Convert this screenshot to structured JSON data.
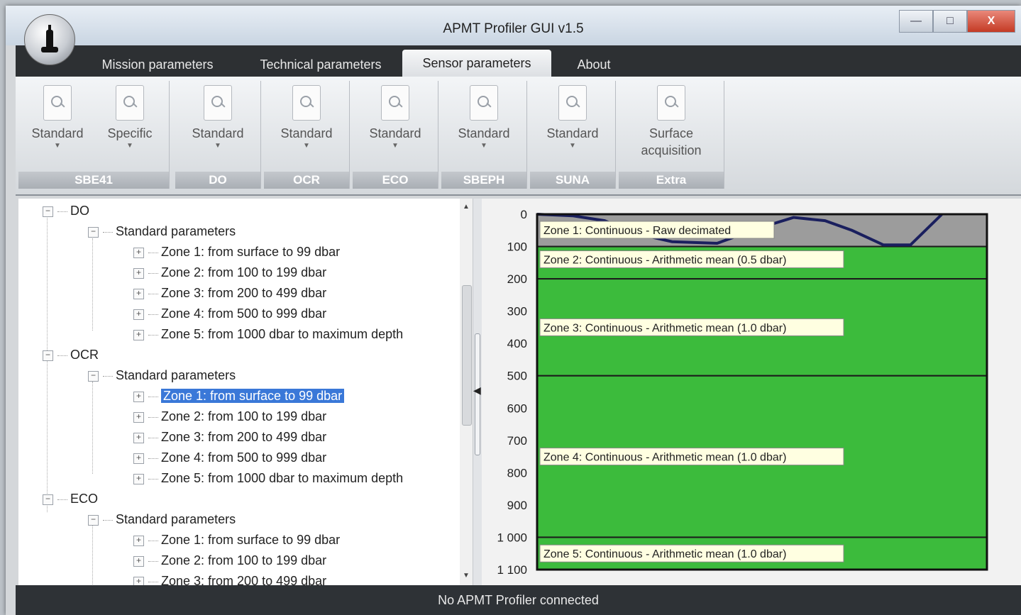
{
  "window": {
    "title": "APMT Profiler GUI v1.5",
    "controls": {
      "minimize": "—",
      "maximize": "□",
      "close": "X"
    }
  },
  "tabs": [
    {
      "label": "Mission parameters",
      "active": false
    },
    {
      "label": "Technical parameters",
      "active": false
    },
    {
      "label": "Sensor parameters",
      "active": true
    },
    {
      "label": "About",
      "active": false
    }
  ],
  "ribbon": {
    "groups": [
      {
        "name": "SBE41",
        "buttons": [
          {
            "label": "Standard",
            "icon": "settings-icon"
          },
          {
            "label": "Specific",
            "icon": "settings-icon"
          }
        ]
      },
      {
        "name": "DO",
        "buttons": [
          {
            "label": "Standard",
            "icon": "settings-icon"
          }
        ]
      },
      {
        "name": "OCR",
        "buttons": [
          {
            "label": "Standard",
            "icon": "settings-icon"
          }
        ]
      },
      {
        "name": "ECO",
        "buttons": [
          {
            "label": "Standard",
            "icon": "settings-icon"
          }
        ]
      },
      {
        "name": "SBEPH",
        "buttons": [
          {
            "label": "Standard",
            "icon": "settings-icon"
          }
        ]
      },
      {
        "name": "SUNA",
        "buttons": [
          {
            "label": "Standard",
            "icon": "settings-icon"
          }
        ]
      },
      {
        "name": "Extra",
        "buttons": [
          {
            "label": "Surface acquisition",
            "icon": "settings-icon"
          }
        ]
      }
    ]
  },
  "tree": {
    "sensors": [
      {
        "name": "DO",
        "group": "Standard parameters",
        "zones": [
          "Zone 1: from surface to 99 dbar",
          "Zone 2: from 100 to 199 dbar",
          "Zone 3: from 200 to 499 dbar",
          "Zone 4: from 500 to 999 dbar",
          "Zone 5: from 1000 dbar to maximum depth"
        ]
      },
      {
        "name": "OCR",
        "group": "Standard parameters",
        "zones": [
          "Zone 1: from surface to 99 dbar",
          "Zone 2: from 100 to 199 dbar",
          "Zone 3: from 200 to 499 dbar",
          "Zone 4: from 500 to 999 dbar",
          "Zone 5: from 1000 dbar to maximum depth"
        ],
        "selected_zone": 0
      },
      {
        "name": "ECO",
        "group": "Standard parameters",
        "zones": [
          "Zone 1: from surface to 99 dbar",
          "Zone 2: from 100 to 199 dbar",
          "Zone 3: from 200 to 499 dbar"
        ]
      }
    ]
  },
  "chart_data": {
    "type": "area",
    "y_axis": {
      "ticks": [
        "0",
        "100",
        "200",
        "300",
        "400",
        "500",
        "600",
        "700",
        "800",
        "900",
        "1 000",
        "1 100"
      ],
      "range": [
        0,
        1100
      ],
      "inverted": true
    },
    "zones": [
      {
        "label": "Zone 1: Continuous - Raw decimated",
        "from": 0,
        "to": 99,
        "color": "#9c9c9c"
      },
      {
        "label": "Zone 2: Continuous - Arithmetic mean (0.5 dbar)",
        "from": 100,
        "to": 199,
        "color": "#3cbb3c"
      },
      {
        "label": "Zone 3: Continuous - Arithmetic mean (1.0 dbar)",
        "from": 200,
        "to": 499,
        "color": "#3cbb3c"
      },
      {
        "label": "Zone 4: Continuous - Arithmetic mean (1.0 dbar)",
        "from": 500,
        "to": 999,
        "color": "#3cbb3c"
      },
      {
        "label": "Zone 5: Continuous - Arithmetic mean (1.0 dbar)",
        "from": 1000,
        "to": 1100,
        "color": "#3cbb3c"
      }
    ],
    "profile_line": {
      "color": "#1a1f5e",
      "x": [
        0,
        0.08,
        0.15,
        0.22,
        0.3,
        0.4,
        0.5,
        0.57,
        0.64,
        0.7,
        0.77,
        0.83,
        0.9
      ],
      "y": [
        0,
        5,
        20,
        60,
        85,
        90,
        40,
        10,
        20,
        50,
        95,
        95,
        0
      ]
    }
  },
  "status": {
    "text": "No APMT Profiler connected"
  }
}
